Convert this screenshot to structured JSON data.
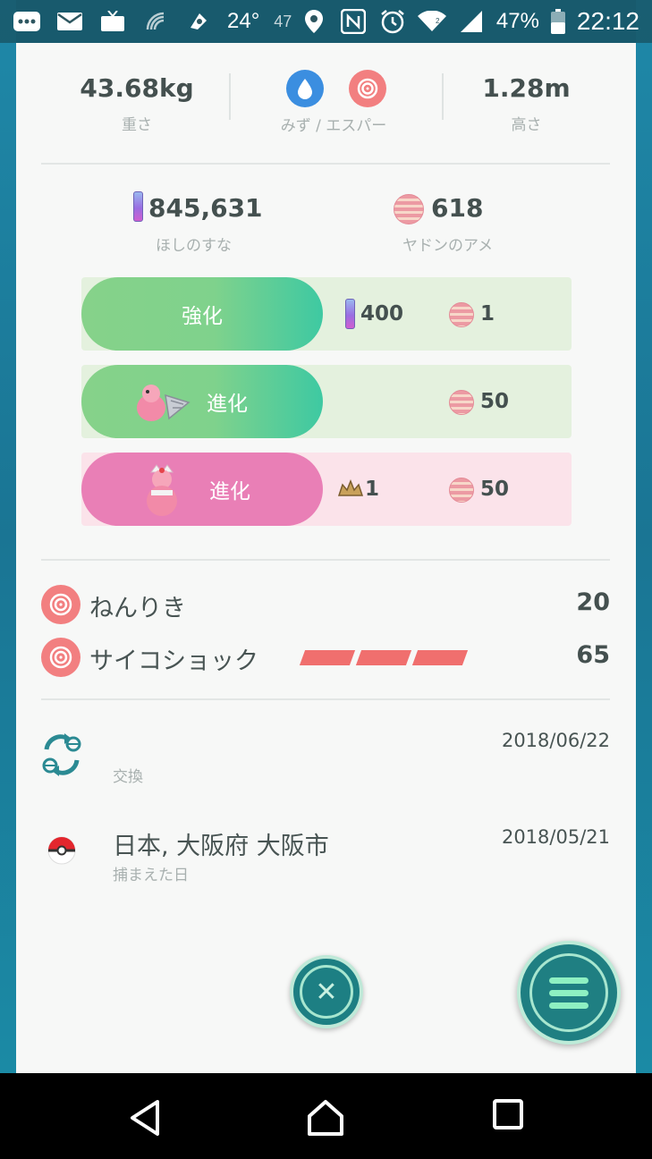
{
  "status_bar": {
    "temperature": "24°",
    "notification_count": "47",
    "battery": "47%",
    "time": "22:12"
  },
  "stats": {
    "weight": {
      "value": "43.68kg",
      "label": "重さ"
    },
    "type": {
      "label": "みず / エスパー",
      "icons": [
        "water-type-icon",
        "psychic-type-icon"
      ]
    },
    "height": {
      "value": "1.28m",
      "label": "高さ"
    }
  },
  "resources": {
    "stardust": {
      "value": "845,631",
      "label": "ほしのすな"
    },
    "candy": {
      "value": "618",
      "label": "ヤドンのアメ"
    }
  },
  "actions": {
    "power_up": {
      "label": "強化",
      "stardust_cost": "400",
      "candy_cost": "1"
    },
    "evolve_bro": {
      "label": "進化",
      "candy_cost": "50"
    },
    "evolve_king": {
      "label": "進化",
      "item_cost": "1",
      "candy_cost": "50"
    }
  },
  "moves": [
    {
      "name": "ねんりき",
      "power": "20"
    },
    {
      "name": "サイコショック",
      "power": "65",
      "energy_bars": 3
    }
  ],
  "history": [
    {
      "title": "",
      "subtitle": "交換",
      "date": "2018/06/22"
    },
    {
      "title": "日本, 大阪府 大阪市",
      "subtitle": "捕まえた日",
      "date": "2018/05/21"
    }
  ],
  "colors": {
    "green_button": "#7fd38c",
    "pink_button": "#e97fb6",
    "green_row": "#e5f2df",
    "pink_row": "#fbe3ea",
    "move_red": "#f27f80"
  }
}
